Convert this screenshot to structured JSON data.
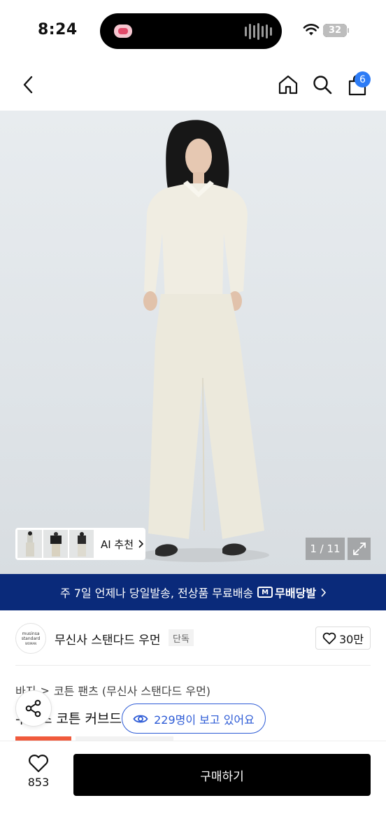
{
  "status_bar": {
    "time": "8:24",
    "battery": "32"
  },
  "header": {
    "cart_count": "6"
  },
  "gallery": {
    "ai_label": "AI 추천",
    "counter": "1 / 11"
  },
  "banner": {
    "text": "주 7일 언제나 당일발송, 전상품 무료배송",
    "logo_box": "M",
    "logo_text": "무배당발"
  },
  "brand": {
    "logo_line1": "musinsa",
    "logo_line2": "standard",
    "logo_line3": "WOMAN",
    "name": "무신사 스탠다드 우먼",
    "exclusive_badge": "단독",
    "likes": "30만"
  },
  "product": {
    "breadcrumb_1": "바지",
    "breadcrumb_2": "코튼 팬츠 (무신사 스탠다드 우먼)",
    "title": "우먼즈 코튼 커브드"
  },
  "overlay": {
    "viewers": "229명이 보고 있어요"
  },
  "bottom": {
    "wish_count": "853",
    "buy_label": "구매하기"
  }
}
